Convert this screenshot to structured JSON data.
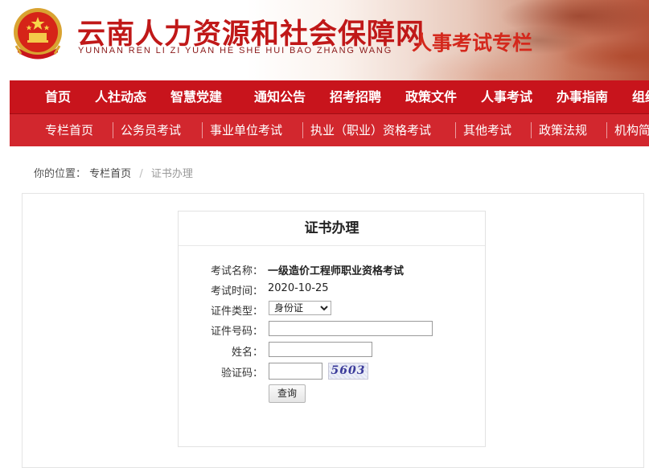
{
  "header": {
    "site_title": "云南人力资源和社会保障网",
    "site_subtitle": "YUNNAN REN LI ZI YUAN HE SHE HUI BAO ZHANG WANG",
    "column_title": "人事考试专栏",
    "colors": {
      "brand_red": "#c8141c",
      "title_red": "#c01818"
    }
  },
  "main_nav": [
    "首页",
    "人社动态",
    "智慧党建",
    "通知公告",
    "招考招聘",
    "政策文件",
    "人事考试",
    "办事指南",
    "组织"
  ],
  "sub_nav": [
    "专栏首页",
    "公务员考试",
    "事业单位考试",
    "执业（职业）资格考试",
    "其他考试",
    "政策法规",
    "机构简"
  ],
  "breadcrumb": {
    "prefix": "你的位置：",
    "home": "专栏首页",
    "divider": "/",
    "current": "证书办理"
  },
  "panel": {
    "title": "证书办理",
    "exam_name_label": "考试名称：",
    "exam_name_value": "一级造价工程师职业资格考试",
    "exam_time_label": "考试时间：",
    "exam_time_value": "2020-10-25",
    "cert_type_label": "证件类型：",
    "cert_type_selected": "身份证",
    "cert_number_label": "证件号码：",
    "name_label": "姓名：",
    "captcha_label": "验证码：",
    "captcha_text": "5603",
    "query_button": "查询"
  }
}
